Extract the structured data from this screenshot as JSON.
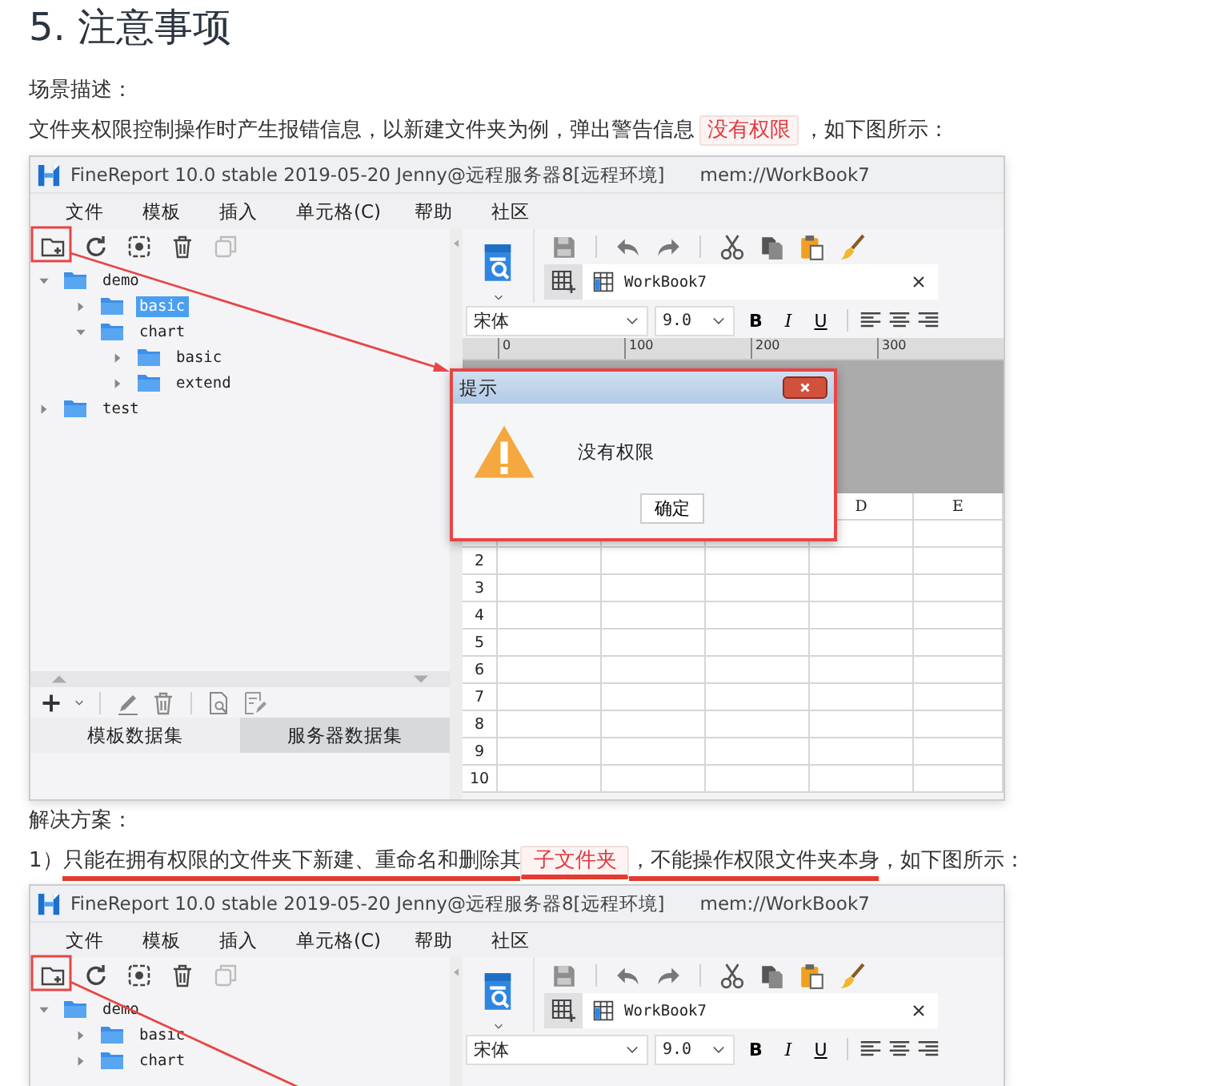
{
  "heading": "5. 注意事项",
  "sections": [
    {
      "label": "场景描述：",
      "text": [
        {
          "text": "文件夹权限控制操作时产生报错信息，以新建文件夹为例，弹出警告信息",
          "kind": "plain",
          "underlined": false
        },
        {
          "text": "没有权限",
          "kind": "tag",
          "underlined": false
        },
        {
          "text": "，如下图所示：",
          "kind": "plain",
          "underlined": false
        }
      ],
      "screenshot": {
        "title": "FineReport 10.0 stable 2019-05-20 Jenny@远程服务器8[远程环境]",
        "path": "mem://WorkBook7",
        "menu": [
          "文件",
          "模板",
          "插入",
          "单元格(C)",
          "帮助",
          "社区"
        ],
        "tree": [
          {
            "label": "demo",
            "expanded": true,
            "selected": false,
            "children": [
              {
                "label": "basic",
                "expanded": false,
                "selected": true
              },
              {
                "label": "chart",
                "expanded": true,
                "selected": false,
                "children": [
                  {
                    "label": "basic",
                    "expanded": false,
                    "selected": false
                  },
                  {
                    "label": "extend",
                    "expanded": false,
                    "selected": false
                  }
                ]
              }
            ]
          },
          {
            "label": "test",
            "expanded": false,
            "selected": false
          }
        ],
        "data_tabs": [
          {
            "label": "模板数据集",
            "selected": true
          },
          {
            "label": "服务器数据集",
            "selected": false
          }
        ],
        "workbook_tab": "WorkBook7",
        "font": {
          "family": "宋体",
          "size": "9.0"
        },
        "format_buttons": [
          "B",
          "I",
          "U"
        ],
        "ruler": [
          "0",
          "100",
          "200",
          "300"
        ],
        "grid": {
          "columns": [
            "D",
            "E"
          ],
          "rows": [
            "2",
            "3",
            "4",
            "5",
            "6",
            "7",
            "8",
            "9",
            "10"
          ]
        },
        "dialog": {
          "title": "提示",
          "message": "没有权限",
          "button": "确定"
        }
      }
    },
    {
      "label": "解决方案：",
      "text": [
        {
          "text": "1）",
          "kind": "plain",
          "underlined": false
        },
        {
          "text": "只能在拥有权限的文件夹下新建、重命名和删除其",
          "kind": "plain",
          "underlined": true
        },
        {
          "text": "子文件夹",
          "kind": "tag",
          "underlined": true
        },
        {
          "text": "，不能操作权限文件夹本身",
          "kind": "plain",
          "underlined": true
        },
        {
          "text": "，如下图所示：",
          "kind": "plain",
          "underlined": false
        }
      ],
      "screenshot": {
        "title": "FineReport 10.0 stable 2019-05-20 Jenny@远程服务器8[远程环境]",
        "path": "mem://WorkBook7",
        "menu": [
          "文件",
          "模板",
          "插入",
          "单元格(C)",
          "帮助",
          "社区"
        ],
        "tree": [
          {
            "label": "demo",
            "expanded": true,
            "selected": false,
            "children": [
              {
                "label": "basic",
                "expanded": false,
                "selected": false
              },
              {
                "label": "chart",
                "expanded": false,
                "selected": false
              }
            ]
          }
        ],
        "workbook_tab": "WorkBook7",
        "font": {
          "family": "宋体",
          "size": "9.0"
        },
        "format_buttons": [
          "B",
          "I",
          "U"
        ]
      }
    }
  ]
}
